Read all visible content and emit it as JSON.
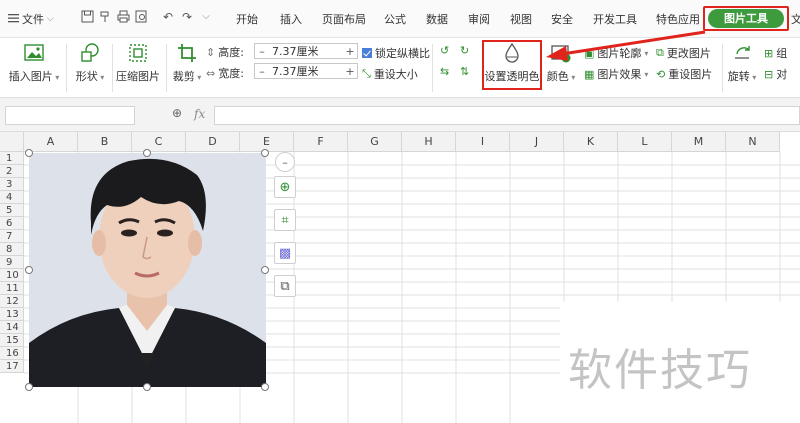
{
  "menu": {
    "file_label": "文件",
    "tabs": [
      "开始",
      "插入",
      "页面布局",
      "公式",
      "数据",
      "审阅",
      "视图",
      "安全",
      "开发工具",
      "特色应用"
    ],
    "active_tab": "图片工具",
    "overflow_label": "文"
  },
  "ribbon": {
    "insert_picture": "插入图片",
    "shape": "形状",
    "compress_picture": "压缩图片",
    "crop": "裁剪",
    "height_label": "高度:",
    "height_value": "7.37厘米",
    "width_label": "宽度:",
    "width_value": "7.37厘米",
    "lock_ratio": "锁定纵横比",
    "reset_size": "重设大小",
    "set_transparent": "设置透明色",
    "color": "颜色",
    "picture_outline": "图片轮廓",
    "picture_effects": "图片效果",
    "change_picture": "更改图片",
    "reset_picture": "重设图片",
    "rotate": "旋转",
    "group": "组",
    "align": "对"
  },
  "formula_bar": {
    "fx": "fx"
  },
  "sheet": {
    "columns": [
      "A",
      "B",
      "C",
      "D",
      "E",
      "F",
      "G",
      "H",
      "I",
      "J",
      "K",
      "L",
      "M",
      "N"
    ],
    "rows": [
      "1",
      "2",
      "3",
      "4",
      "5",
      "6",
      "7",
      "8",
      "9",
      "10",
      "11",
      "12",
      "13",
      "14",
      "15",
      "16",
      "17"
    ]
  },
  "watermark": "软件技巧",
  "colors": {
    "accent_green": "#3d9a3d",
    "highlight_red": "#e0241b"
  }
}
